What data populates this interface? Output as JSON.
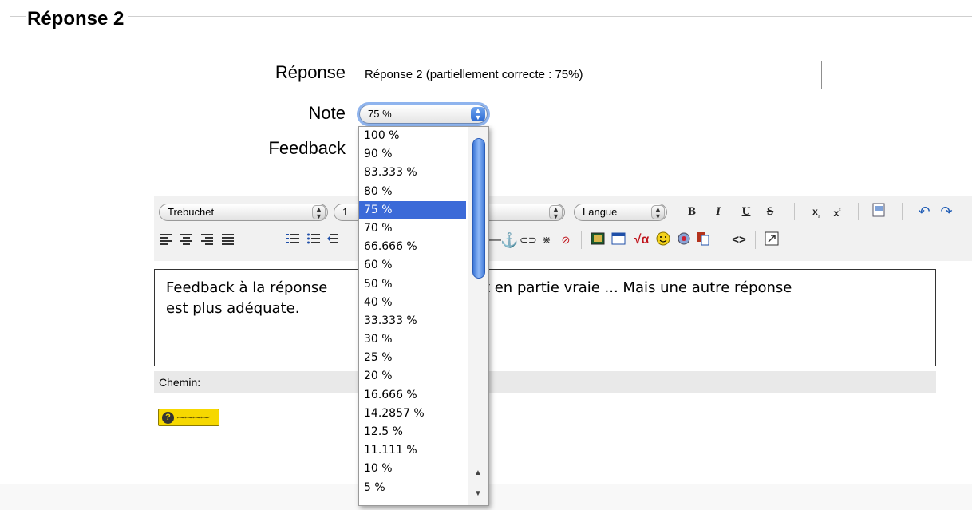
{
  "section": {
    "legend": "Réponse 2"
  },
  "form": {
    "answer_label": "Réponse",
    "answer_value": "Réponse 2 (partiellement correcte : 75%)",
    "note_label": "Note",
    "note_selected": "75 %",
    "feedback_label": "Feedback"
  },
  "toolbar": {
    "font_family": "Trebuchet",
    "font_size_partial": "1",
    "language": "Langue",
    "bold": "B",
    "italic": "I",
    "underline": "U",
    "strike": "S"
  },
  "editor": {
    "text_before": "Feedback à la réponse",
    "text_after": "se est en partie vraie ... Mais une autre réponse",
    "text_line2": "est plus adéquate."
  },
  "path_bar": {
    "label": "Chemin:"
  },
  "dropdown": {
    "options": [
      "100 %",
      "90 %",
      "83.333 %",
      "80 %",
      "75 %",
      "70 %",
      "66.666 %",
      "60 %",
      "50 %",
      "40 %",
      "33.333 %",
      "30 %",
      "25 %",
      "20 %",
      "16.666 %",
      "14.2857 %",
      "12.5 %",
      "11.111 %",
      "10 %",
      "5 %"
    ],
    "selected_index": 4
  },
  "colors": {
    "selection": "#3b6ad8",
    "focus_ring": "#8fb4ee",
    "help_badge": "#f6d800"
  },
  "icons": [
    "align-left-icon",
    "align-center-icon",
    "align-right-icon",
    "justify-icon",
    "ordered-list-icon",
    "unordered-list-icon",
    "anchor-icon",
    "link-icon",
    "unlink-icon",
    "image-icon",
    "table-icon",
    "math-icon",
    "smiley-icon",
    "nolink-icon",
    "paste-word-icon",
    "html-source-icon",
    "fullscreen-icon",
    "undo-icon",
    "redo-icon",
    "subscript-icon",
    "superscript-icon",
    "clean-word-icon",
    "help-icon"
  ]
}
